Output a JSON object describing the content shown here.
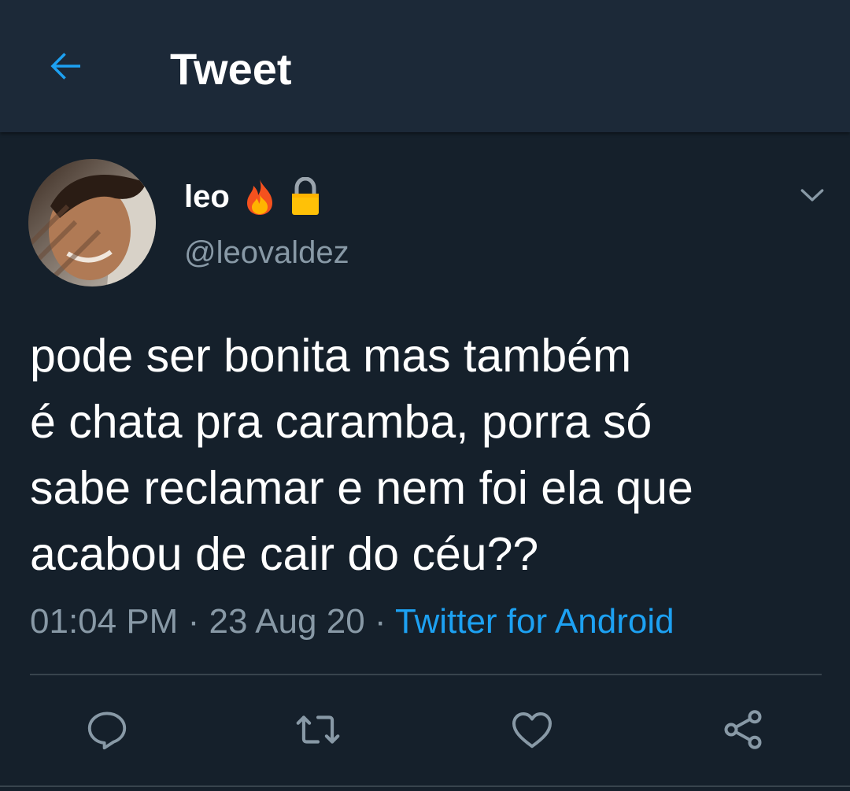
{
  "header": {
    "title": "Tweet",
    "back_icon": "arrow-left-icon"
  },
  "tweet": {
    "author": {
      "display_name": "leo",
      "badges": [
        "fire-emoji",
        "lock-emoji"
      ],
      "handle": "@leovaldez"
    },
    "text": "pode ser bonita mas também\né chata pra caramba, porra só\nsabe reclamar e nem foi ela que\nacabou de cair do céu??",
    "time": "01:04 PM",
    "date": "23 Aug 20",
    "separator": "·",
    "source": "Twitter for Android",
    "actions": [
      "reply-icon",
      "retweet-icon",
      "like-icon",
      "share-icon"
    ]
  },
  "colors": {
    "background": "#15202b",
    "header_background": "#1c2938",
    "accent": "#1da1f2",
    "secondary_text": "#8899a6",
    "divider": "#38444d"
  }
}
